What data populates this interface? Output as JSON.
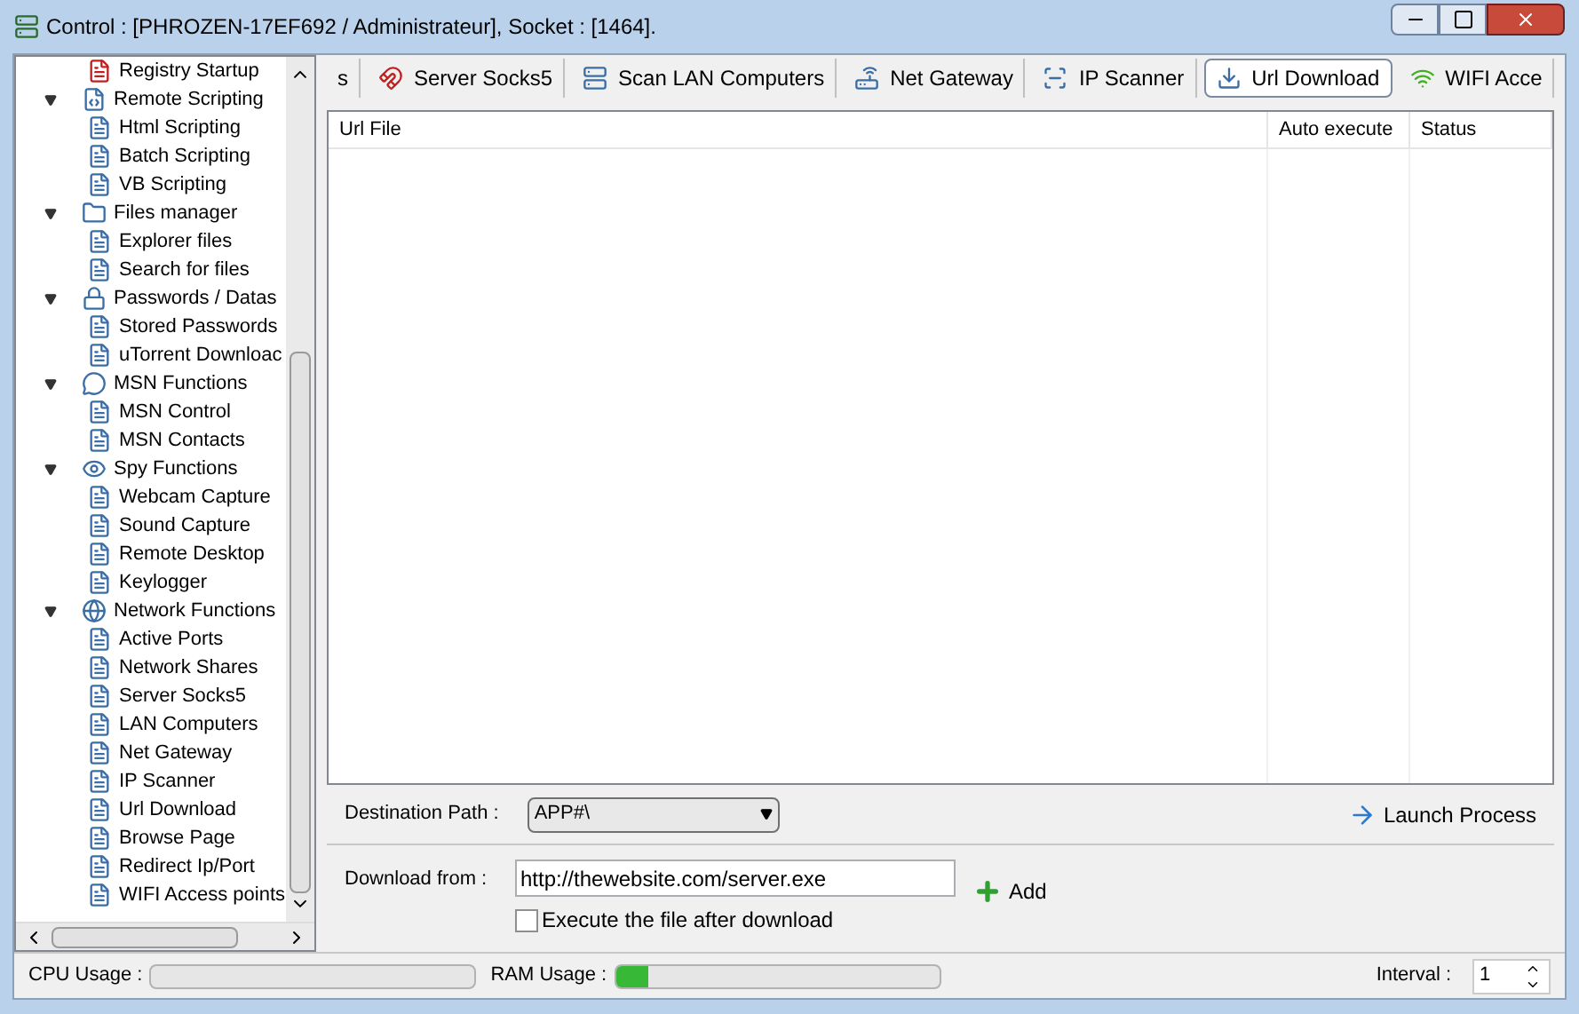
{
  "window": {
    "title": "Control : [PHROZEN-17EF692 / Administrateur], Socket : [1464]."
  },
  "tree": [
    {
      "kind": "leaf",
      "label": "Registry Startup"
    },
    {
      "kind": "group",
      "label": "Remote Scripting",
      "expanded": true,
      "children": [
        {
          "label": "Html Scripting"
        },
        {
          "label": "Batch Scripting"
        },
        {
          "label": "VB Scripting"
        }
      ]
    },
    {
      "kind": "group",
      "label": "Files manager",
      "expanded": true,
      "children": [
        {
          "label": "Explorer files"
        },
        {
          "label": "Search for files"
        }
      ]
    },
    {
      "kind": "group",
      "label": "Passwords / Datas",
      "expanded": true,
      "children": [
        {
          "label": "Stored Passwords"
        },
        {
          "label": "uTorrent Downloac"
        }
      ]
    },
    {
      "kind": "group",
      "label": "MSN Functions",
      "expanded": true,
      "children": [
        {
          "label": "MSN Control"
        },
        {
          "label": "MSN Contacts"
        }
      ]
    },
    {
      "kind": "group",
      "label": "Spy Functions",
      "expanded": true,
      "children": [
        {
          "label": "Webcam Capture"
        },
        {
          "label": "Sound Capture"
        },
        {
          "label": "Remote Desktop"
        },
        {
          "label": "Keylogger"
        }
      ]
    },
    {
      "kind": "group",
      "label": "Network Functions",
      "expanded": true,
      "children": [
        {
          "label": "Active Ports"
        },
        {
          "label": "Network Shares"
        },
        {
          "label": "Server Socks5"
        },
        {
          "label": "LAN Computers"
        },
        {
          "label": "Net Gateway"
        },
        {
          "label": "IP Scanner"
        },
        {
          "label": "Url Download"
        },
        {
          "label": "Browse Page"
        },
        {
          "label": "Redirect Ip/Port"
        },
        {
          "label": "WIFI Access points"
        }
      ]
    }
  ],
  "tabs": [
    {
      "label": "s",
      "selected": false
    },
    {
      "label": "Server Socks5",
      "selected": false
    },
    {
      "label": "Scan LAN Computers",
      "selected": false
    },
    {
      "label": "Net Gateway",
      "selected": false
    },
    {
      "label": "IP Scanner",
      "selected": false
    },
    {
      "label": "Url Download",
      "selected": true
    },
    {
      "label": "WIFI Acce",
      "selected": false
    }
  ],
  "table": {
    "columns": [
      "Url File",
      "Auto execute",
      "Status"
    ]
  },
  "destination": {
    "label": "Destination Path :",
    "value": "APP#\\"
  },
  "launch_button": "Launch Process",
  "download": {
    "label": "Download from :",
    "value": "http://thewebsite.com/server.exe"
  },
  "execute_checkbox": {
    "label": "Execute the file after download",
    "checked": false
  },
  "add_button": "Add",
  "status_bar": {
    "cpu": {
      "label": "CPU Usage :",
      "level": 0
    },
    "ram": {
      "label": "RAM Usage :",
      "level": 0.1
    },
    "interval": {
      "label": "Interval :",
      "value": "1"
    }
  }
}
